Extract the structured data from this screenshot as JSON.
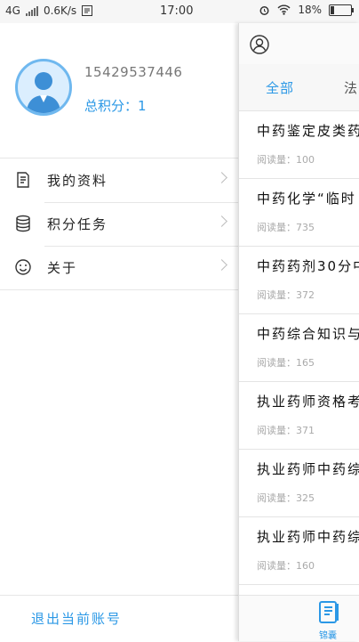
{
  "status_bar": {
    "network": "4G",
    "speed": "0.6K/s",
    "time": "17:00",
    "battery": "18%"
  },
  "profile": {
    "phone": "15429537446",
    "points_label": "总积分：1"
  },
  "menu": [
    {
      "label": "我的资料",
      "icon": "document-icon"
    },
    {
      "label": "积分任务",
      "icon": "database-icon"
    },
    {
      "label": "关于",
      "icon": "smiley-icon"
    }
  ],
  "logout": {
    "label": "退出当前账号"
  },
  "tabs": [
    {
      "label": "全部",
      "active": true
    },
    {
      "label": "法",
      "active": false
    }
  ],
  "articles": [
    {
      "title": "中药鉴定皮类药",
      "reads": "阅读量：100"
    },
    {
      "title": "中药化学“临时",
      "reads": "阅读量：735"
    },
    {
      "title": "中药药剂30分中",
      "reads": "阅读量：372"
    },
    {
      "title": "中药综合知识与",
      "reads": "阅读量：165"
    },
    {
      "title": "执业药师资格考",
      "reads": "阅读量：371"
    },
    {
      "title": "执业药师中药综",
      "reads": "阅读量：325"
    },
    {
      "title": "执业药师中药综",
      "reads": "阅读量：160"
    }
  ],
  "bottom_nav": {
    "label": "锦囊",
    "icon": "book-icon"
  },
  "colors": {
    "accent": "#2b98e6",
    "divider": "#e6e6e6"
  }
}
